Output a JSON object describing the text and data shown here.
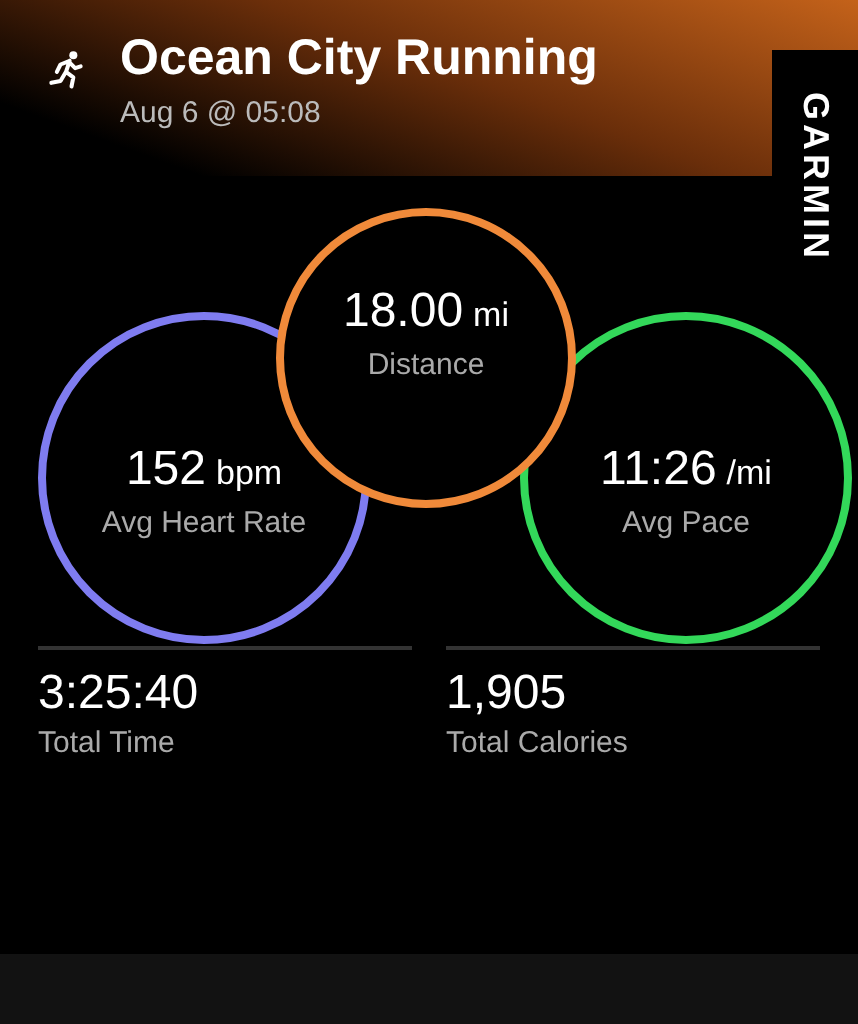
{
  "header": {
    "title": "Ocean City Running",
    "subtitle": "Aug 6 @ 05:08",
    "brand": "GARMIN"
  },
  "metrics": [
    {
      "value": "152",
      "unit": "bpm",
      "label": "Avg Heart Rate",
      "color": "#7f7cf0"
    },
    {
      "value": "18.00",
      "unit": "mi",
      "label": "Distance",
      "color": "#f08a3a"
    },
    {
      "value": "11:26",
      "unit": "/mi",
      "label": "Avg Pace",
      "color": "#33d85a"
    }
  ],
  "stats": [
    {
      "value": "3:25:40",
      "label": "Total Time"
    },
    {
      "value": "1,905",
      "label": "Total Calories"
    }
  ]
}
